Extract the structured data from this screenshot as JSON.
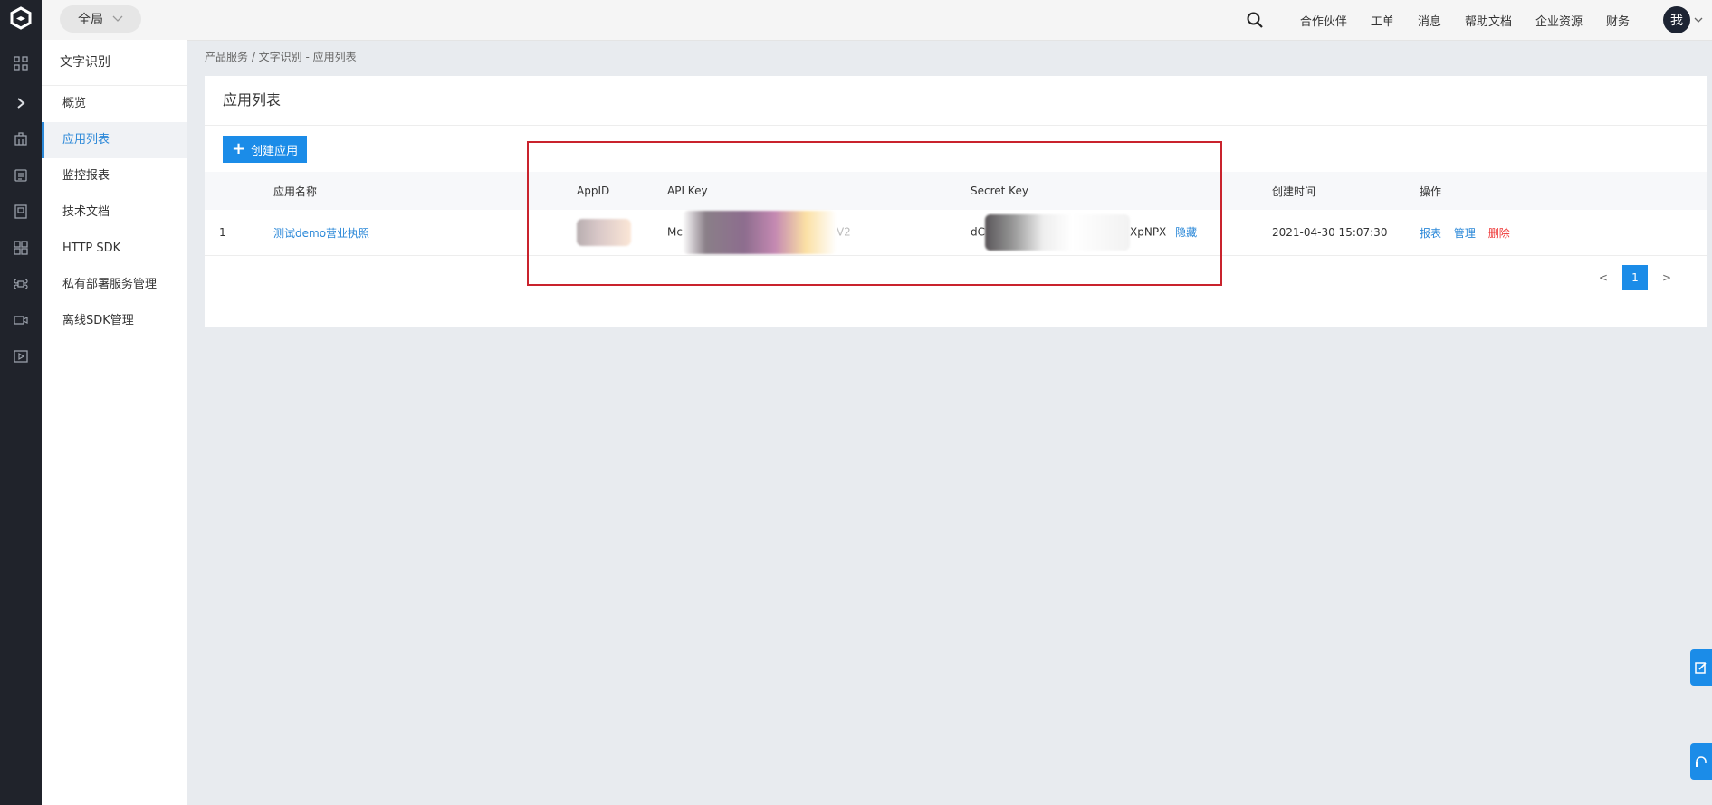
{
  "topbar": {
    "region": "全局",
    "nav": [
      "合作伙伴",
      "工单",
      "消息",
      "帮助文档",
      "企业资源",
      "财务"
    ],
    "avatar_text": "我"
  },
  "rail": {
    "icons": [
      "logo-icon",
      "grid-icon",
      "chevron-right-icon",
      "building-icon",
      "document-icon",
      "book-icon",
      "apps-icon",
      "command-icon",
      "video-icon",
      "play-icon"
    ]
  },
  "subnav": {
    "title": "文字识别",
    "items": [
      "概览",
      "应用列表",
      "监控报表",
      "技术文档",
      "HTTP SDK",
      "私有部署服务管理",
      "离线SDK管理"
    ],
    "active_index": 1
  },
  "breadcrumb": "产品服务  /  文字识别 - 应用列表",
  "panel": {
    "title": "应用列表",
    "create_button": "创建应用"
  },
  "table": {
    "columns": [
      "",
      "应用名称",
      "AppID",
      "API Key",
      "Secret Key",
      "创建时间",
      "操作"
    ],
    "rows": [
      {
        "index": "1",
        "name": "测试demo营业执照",
        "api_key_prefix": "Mc",
        "api_key_suffix": "V2",
        "secret_prefix": "dC",
        "secret_suffix": "XpNPX",
        "hide_label": "隐藏",
        "created": "2021-04-30 15:07:30",
        "ops": [
          "报表",
          "管理",
          "删除"
        ]
      }
    ]
  },
  "pager": {
    "prev": "<",
    "current": "1",
    "next": ">"
  },
  "colors": {
    "accent": "#1b8ce8",
    "danger": "#e33333",
    "rail_bg": "#20232b",
    "highlight": "#c9232d"
  }
}
